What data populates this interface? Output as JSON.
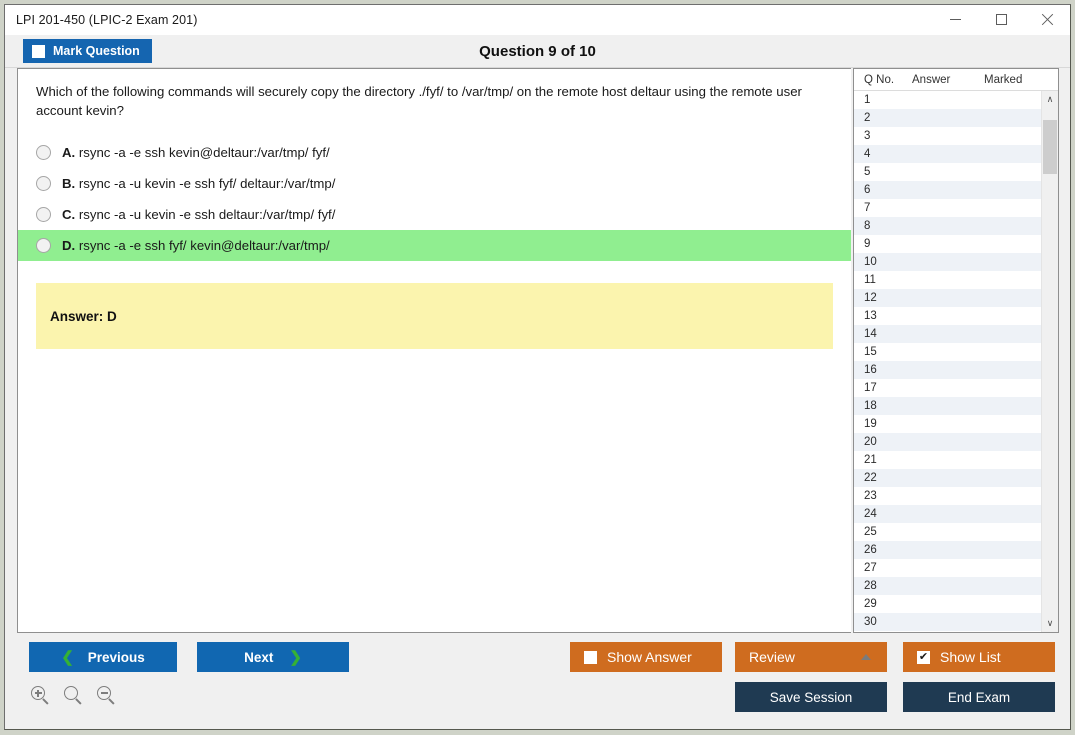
{
  "window": {
    "title": "LPI 201-450 (LPIC-2 Exam 201)",
    "minimize_label": "Minimize",
    "maximize_label": "Maximize",
    "close_label": "Close"
  },
  "header": {
    "mark_question_label": "Mark Question",
    "mark_question_checked": false,
    "question_counter": "Question 9 of 10"
  },
  "question": {
    "text": "Which of the following commands will securely copy the directory ./fyf/ to /var/tmp/ on the remote host deltaur using the remote user account kevin?",
    "options": [
      {
        "letter": "A.",
        "text": "rsync -a -e ssh kevin@deltaur:/var/tmp/ fyf/",
        "selected": false,
        "correct": false
      },
      {
        "letter": "B.",
        "text": "rsync -a -u kevin -e ssh fyf/ deltaur:/var/tmp/",
        "selected": false,
        "correct": false
      },
      {
        "letter": "C.",
        "text": "rsync -a -u kevin -e ssh deltaur:/var/tmp/ fyf/",
        "selected": false,
        "correct": false
      },
      {
        "letter": "D.",
        "text": "rsync -a -e ssh fyf/ kevin@deltaur:/var/tmp/",
        "selected": false,
        "correct": true
      }
    ],
    "answer_label": "Answer: D"
  },
  "question_list": {
    "columns": [
      "Q No.",
      "Answer",
      "Marked"
    ],
    "rows": [
      {
        "no": "1",
        "answer": "",
        "marked": ""
      },
      {
        "no": "2",
        "answer": "",
        "marked": ""
      },
      {
        "no": "3",
        "answer": "",
        "marked": ""
      },
      {
        "no": "4",
        "answer": "",
        "marked": ""
      },
      {
        "no": "5",
        "answer": "",
        "marked": ""
      },
      {
        "no": "6",
        "answer": "",
        "marked": ""
      },
      {
        "no": "7",
        "answer": "",
        "marked": ""
      },
      {
        "no": "8",
        "answer": "",
        "marked": ""
      },
      {
        "no": "9",
        "answer": "",
        "marked": ""
      },
      {
        "no": "10",
        "answer": "",
        "marked": ""
      },
      {
        "no": "11",
        "answer": "",
        "marked": ""
      },
      {
        "no": "12",
        "answer": "",
        "marked": ""
      },
      {
        "no": "13",
        "answer": "",
        "marked": ""
      },
      {
        "no": "14",
        "answer": "",
        "marked": ""
      },
      {
        "no": "15",
        "answer": "",
        "marked": ""
      },
      {
        "no": "16",
        "answer": "",
        "marked": ""
      },
      {
        "no": "17",
        "answer": "",
        "marked": ""
      },
      {
        "no": "18",
        "answer": "",
        "marked": ""
      },
      {
        "no": "19",
        "answer": "",
        "marked": ""
      },
      {
        "no": "20",
        "answer": "",
        "marked": ""
      },
      {
        "no": "21",
        "answer": "",
        "marked": ""
      },
      {
        "no": "22",
        "answer": "",
        "marked": ""
      },
      {
        "no": "23",
        "answer": "",
        "marked": ""
      },
      {
        "no": "24",
        "answer": "",
        "marked": ""
      },
      {
        "no": "25",
        "answer": "",
        "marked": ""
      },
      {
        "no": "26",
        "answer": "",
        "marked": ""
      },
      {
        "no": "27",
        "answer": "",
        "marked": ""
      },
      {
        "no": "28",
        "answer": "",
        "marked": ""
      },
      {
        "no": "29",
        "answer": "",
        "marked": ""
      },
      {
        "no": "30",
        "answer": "",
        "marked": ""
      }
    ],
    "scroll_up_glyph": "∧",
    "scroll_down_glyph": "∨"
  },
  "footer": {
    "previous_label": "Previous",
    "next_label": "Next",
    "prev_chevron": "❮",
    "next_chevron": "❯",
    "show_answer_label": "Show Answer",
    "show_answer_checked": false,
    "review_label": "Review",
    "show_list_label": "Show List",
    "show_list_checked": true,
    "save_session_label": "Save Session",
    "end_exam_label": "End Exam",
    "checkmark_glyph": "✔",
    "zoom_in_label": "Zoom In",
    "zoom_reset_label": "Zoom Reset",
    "zoom_out_label": "Zoom Out"
  },
  "colors": {
    "primary_blue": "#1167b1",
    "accent_orange": "#cf6c1f",
    "navy": "#1f3a52",
    "correct_green": "#90ee90",
    "answer_yellow": "#fbf4ae",
    "chevron_green": "#35b135"
  }
}
